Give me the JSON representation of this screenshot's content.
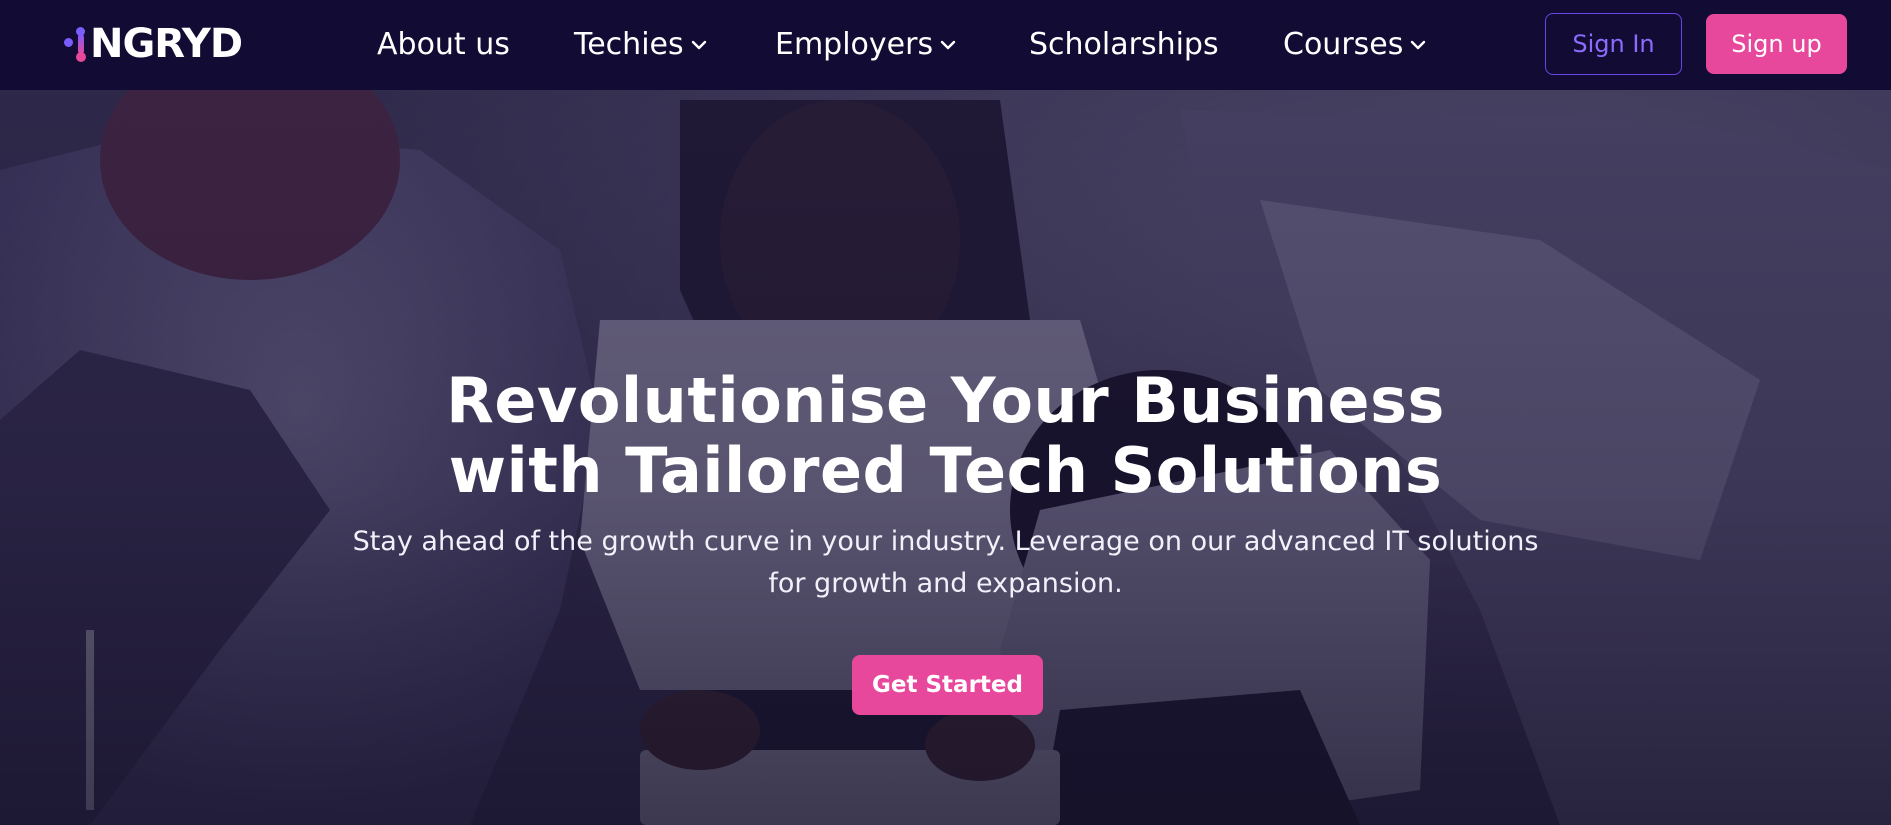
{
  "brand": {
    "logo_text": "NGRYD",
    "colors": {
      "nav_bg": "#120b33",
      "accent_pink": "#e8489c",
      "accent_purple": "#7b5cff"
    }
  },
  "nav": {
    "items": [
      {
        "label": "About us",
        "has_dropdown": false,
        "icon": ""
      },
      {
        "label": "Techies",
        "has_dropdown": true,
        "icon": "chevron-down-icon"
      },
      {
        "label": "Employers",
        "has_dropdown": true,
        "icon": "chevron-down-icon"
      },
      {
        "label": "Scholarships",
        "has_dropdown": false,
        "icon": ""
      },
      {
        "label": "Courses",
        "has_dropdown": true,
        "icon": "chevron-down-icon"
      }
    ],
    "signin_label": "Sign In",
    "signup_label": "Sign up"
  },
  "hero": {
    "title_line1": "Revolutionise Your Business",
    "title_line2": "with Tailored Tech Solutions",
    "subtitle": "Stay ahead of the growth curve in your industry. Leverage on our advanced IT solutions for growth and expansion.",
    "cta_label": "Get Started",
    "background": "team-photo-image"
  }
}
